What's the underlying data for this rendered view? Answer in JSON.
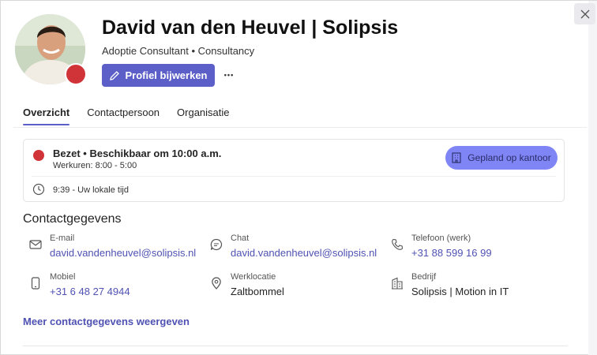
{
  "profile": {
    "name": "David van den Heuvel | Solipsis",
    "subtitle": "Adoptie Consultant • Consultancy",
    "presence_color": "#d13438"
  },
  "actions": {
    "update_profile_label": "Profiel bijwerken",
    "more_label": "•••",
    "close_icon": "close-icon"
  },
  "tabs": [
    {
      "label": "Overzicht",
      "active": true
    },
    {
      "label": "Contactpersoon",
      "active": false
    },
    {
      "label": "Organisatie",
      "active": false
    }
  ],
  "status": {
    "main": "Bezet • Beschikbaar om 10:00 a.m.",
    "hours": "Werkuren: 8:00 - 5:00",
    "local_time": "9:39 - Uw lokale tijd",
    "office_button": "Gepland op kantoor"
  },
  "contact": {
    "title": "Contactgegevens",
    "items": [
      {
        "icon": "mail-icon",
        "label": "E-mail",
        "value": "david.vandenheuvel@solipsis.nl",
        "link": true
      },
      {
        "icon": "chat-icon",
        "label": "Chat",
        "value": "david.vandenheuvel@solipsis.nl",
        "link": true
      },
      {
        "icon": "phone-icon",
        "label": "Telefoon (werk)",
        "value": "+31 88 599 16 99",
        "link": true
      },
      {
        "icon": "mobile-icon",
        "label": "Mobiel",
        "value": "+31 6 48 27 4944",
        "link": true
      },
      {
        "icon": "location-icon",
        "label": "Werklocatie",
        "value": "Zaltbommel",
        "link": false
      },
      {
        "icon": "building-icon",
        "label": "Bedrijf",
        "value": "Solipsis | Motion in IT",
        "link": false
      }
    ],
    "more_link": "Meer contactgegevens weergeven"
  },
  "colors": {
    "accent": "#5b5fc7",
    "link": "#4f52b2",
    "busy": "#d13438",
    "office_button": "#7f85f5"
  }
}
